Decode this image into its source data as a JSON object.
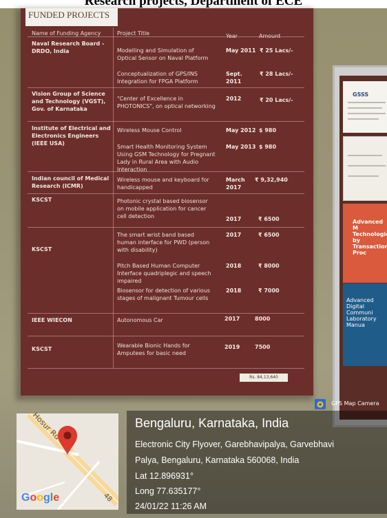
{
  "caption": "Research projects, Department of ECE",
  "poster": {
    "header": "FUNDED PROJECTS",
    "columns": [
      "Name of Funding Agency",
      "Project Title",
      "Year",
      "Amount"
    ],
    "rows": [
      {
        "agency": "Naval Research Board - DRDO, India",
        "projects": [
          {
            "title": "Modelling and Simulation of Optical Sensor on Naval Platform",
            "year": "May 2011",
            "amount": "₹ 25 Lacs/-"
          },
          {
            "title": "Conceptualization of GPS/INS Integration for FPGA Platform",
            "year": "Sept. 2011",
            "amount": "₹ 28 Lacs/-"
          }
        ]
      },
      {
        "agency": "Vision Group of Science and Technology (VGST), Gov. of Karnataka",
        "projects": [
          {
            "title": "\"Center of Excellence in PHOTONICS\", on optical networking",
            "year": "2012",
            "amount": "₹ 20 Lacs/-"
          }
        ]
      },
      {
        "agency": "Institute of Electrical and Electronics Engineers (IEEE USA)",
        "projects": [
          {
            "title": "Wireless Mouse Control",
            "year": "May 2012",
            "amount": "$ 980"
          },
          {
            "title": "Smart Health Monitoring System Using GSM Technology for Pregnant Lady in Rural Area with Audio Interaction",
            "year": "May 2013",
            "amount": "$ 980"
          }
        ]
      },
      {
        "agency": "Indian council of Medical Research (ICMR)",
        "projects": [
          {
            "title": "Wireless mouse and keyboard for handicapped",
            "year": "March 2017",
            "amount": "₹ 9,32,940"
          }
        ]
      },
      {
        "agency": "KSCST",
        "projects": [
          {
            "title": "Photonic crystal based biosensor on mobile application for cancer cell detection",
            "year": "2017",
            "amount": "₹ 6500"
          }
        ]
      },
      {
        "agency": "KSCST",
        "projects": [
          {
            "title": "The smart wrist band based human interface for PWD (person with disability)",
            "year": "2017",
            "amount": "₹ 6500"
          },
          {
            "title": "Pitch Based Human Computer Interface quadriplegic and speech impaired",
            "year": "2018",
            "amount": "₹ 8000"
          },
          {
            "title": "Biosensor for detection of various stages of malignant Tumour cells",
            "year": "2018",
            "amount": "₹ 7000"
          }
        ]
      },
      {
        "agency": "IEEE WIECON",
        "projects": [
          {
            "title": "Autonomous Car",
            "year": "2017",
            "amount": "8000"
          }
        ]
      },
      {
        "agency": "KSCST",
        "projects": [
          {
            "title": "Wearable Bionic Hands  for Amputees for basic need",
            "year": "2019",
            "amount": "7500"
          }
        ]
      }
    ],
    "total": "Rs. 84,13,640"
  },
  "board": {
    "doc1_title": "GSSS",
    "doc3_text": "Advanced M Technologies by Transaction Proc",
    "doc4_text": "Advanced Digital Communi Laboratory Manua"
  },
  "map": {
    "road_label": "Hosur Rd",
    "route_number": "48",
    "logo": "Google",
    "logo_colors": [
      "#4285F4",
      "#EA4335",
      "#FBBC05",
      "#4285F4",
      "#34A853",
      "#EA4335"
    ]
  },
  "gps": {
    "badge": "GPS Map Camera",
    "title": "Bengaluru, Karnataka, India",
    "address_line1": "Electronic City Flyover, Garebhavipalya, Garvebhavi",
    "address_line2": "Palya, Bengaluru, Karnataka 560068, India",
    "lat": "Lat 12.896931°",
    "long": "Long 77.635177°",
    "datetime": "24/01/22 11:26 AM"
  }
}
